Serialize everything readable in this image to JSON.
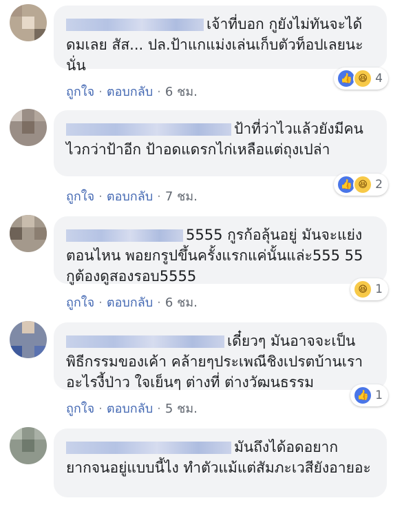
{
  "colors": {
    "bubble_bg": "#f2f3f5",
    "link": "#4267b2",
    "like": "#4a76e8",
    "haha": "#f7c948"
  },
  "comments": [
    {
      "text": "เจ้าที่บอก กูยังไม่ทันจะได้ดมเลย สัส... ปล.ป้าแกแม่งเล่นเก็บตัวท็อปเลยนะนั่น",
      "like": "ถูกใจ",
      "reply": "ตอบกลับ",
      "time": "6 ชม.",
      "reaction_icons": [
        "like-icon",
        "haha-icon"
      ],
      "reaction_count": "4"
    },
    {
      "text": "ป้าที่ว่าไวแล้วยังมีคนไวกว่าป้าอีก ป้าอดแดรกไก่เหลือแต่ถุงเปล่า",
      "like": "ถูกใจ",
      "reply": "ตอบกลับ",
      "time": "7 ชม.",
      "reaction_icons": [
        "like-icon",
        "haha-icon"
      ],
      "reaction_count": "2"
    },
    {
      "text": "5555 กูรก้อลุ้นอยู่ มันจะแย่งตอนไหน พอยกรูปขึ้นครั้งแรกแค่นั้นแล่ะ555 55 กูต้องดูสองรอบ5555",
      "like": "ถูกใจ",
      "reply": "ตอบกลับ",
      "time": "6 ชม.",
      "reaction_icons": [
        "haha-icon"
      ],
      "reaction_count": "1"
    },
    {
      "text": "เดี๋ยวๆ มันอาจจะเป็นพิธีกรรมของเค้า คล้ายๆประเพณีชิงเปรตบ้านเราอะไรงี้ป่าว ใจเย็นๆ ต่างที่ ต่างวัฒนธรรม",
      "like": "ถูกใจ",
      "reply": "ตอบกลับ",
      "time": "5 ชม.",
      "reaction_icons": [
        "like-icon"
      ],
      "reaction_count": "1"
    },
    {
      "text": "มันถึงได้อดอยากยากจนอยู่แบบนี้ไง ทำตัวแม้แต่สัมภะเวสียังอายอะ",
      "like": "",
      "reply": "",
      "time": "",
      "reaction_icons": [],
      "reaction_count": ""
    }
  ]
}
